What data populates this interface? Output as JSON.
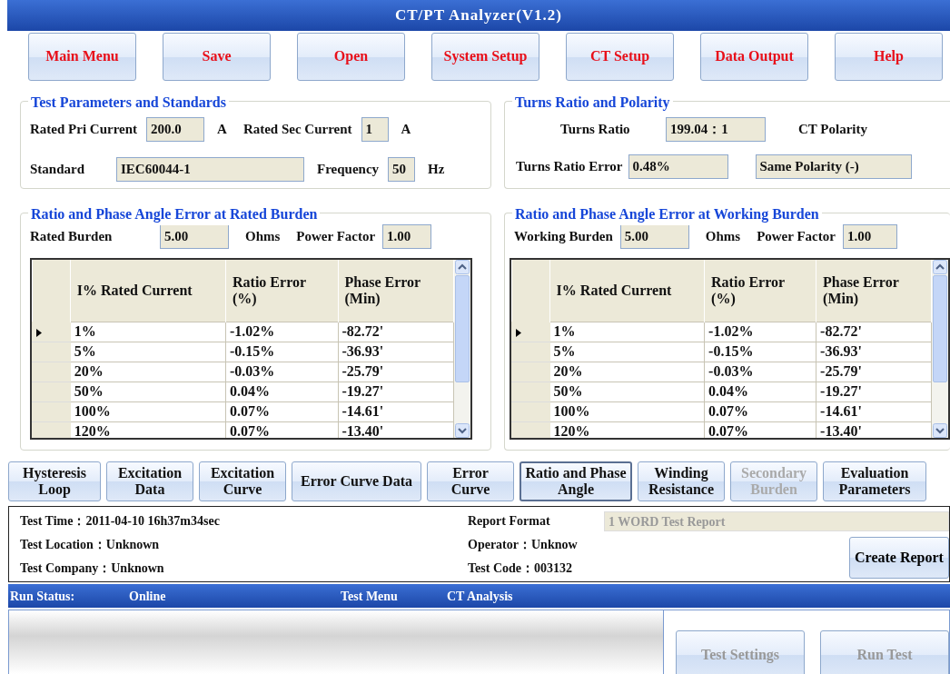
{
  "window": {
    "title": "CT/PT Analyzer(V1.2)"
  },
  "toolbar": [
    {
      "label": "Main Menu"
    },
    {
      "label": "Save"
    },
    {
      "label": "Open"
    },
    {
      "label": "System Setup"
    },
    {
      "label": "CT Setup"
    },
    {
      "label": "Data Output"
    },
    {
      "label": "Help"
    }
  ],
  "test_parameters": {
    "title": "Test Parameters and Standards",
    "rated_pri_label": "Rated Pri Current",
    "rated_pri_value": "200.0",
    "rated_pri_unit": "A",
    "rated_sec_label": "Rated Sec Current",
    "rated_sec_value": "1",
    "rated_sec_unit": "A",
    "standard_label": "Standard",
    "standard_value": "IEC60044-1",
    "frequency_label": "Frequency",
    "frequency_value": "50",
    "frequency_unit": "Hz"
  },
  "turns_ratio": {
    "title": "Turns Ratio and Polarity",
    "ratio_label": "Turns Ratio",
    "ratio_value": "199.04：1",
    "polarity_label": "CT Polarity",
    "error_label": "Turns Ratio Error",
    "error_value": "0.48%",
    "polarity_value": "Same Polarity (-)"
  },
  "burden_panels": [
    {
      "title": "Ratio and Phase Angle Error at Rated Burden",
      "burden_label": "Rated Burden",
      "burden_value": "5.00",
      "burden_unit": "Ohms",
      "pf_label": "Power Factor",
      "pf_value": "1.00",
      "table": {
        "columns": [
          "I% Rated Current",
          "Ratio Error (%)",
          "Phase Error (Min)"
        ],
        "rows": [
          {
            "cells": [
              "1%",
              "-1.02%",
              "-82.72'"
            ],
            "selected": true
          },
          {
            "cells": [
              "5%",
              "-0.15%",
              "-36.93'"
            ],
            "selected": false
          },
          {
            "cells": [
              "20%",
              "-0.03%",
              "-25.79'"
            ],
            "selected": false
          },
          {
            "cells": [
              "50%",
              "0.04%",
              "-19.27'"
            ],
            "selected": false
          },
          {
            "cells": [
              "100%",
              "0.07%",
              "-14.61'"
            ],
            "selected": false
          },
          {
            "cells": [
              "120%",
              "0.07%",
              "-13.40'"
            ],
            "selected": false
          }
        ]
      }
    },
    {
      "title": "Ratio and Phase Angle Error at Working Burden",
      "burden_label": "Working Burden",
      "burden_value": "5.00",
      "burden_unit": "Ohms",
      "pf_label": "Power Factor",
      "pf_value": "1.00",
      "table": {
        "columns": [
          "I% Rated Current",
          "Ratio Error (%)",
          "Phase Error (Min)"
        ],
        "rows": [
          {
            "cells": [
              "1%",
              "-1.02%",
              "-82.72'"
            ],
            "selected": true
          },
          {
            "cells": [
              "5%",
              "-0.15%",
              "-36.93'"
            ],
            "selected": false
          },
          {
            "cells": [
              "20%",
              "-0.03%",
              "-25.79'"
            ],
            "selected": false
          },
          {
            "cells": [
              "50%",
              "0.04%",
              "-19.27'"
            ],
            "selected": false
          },
          {
            "cells": [
              "100%",
              "0.07%",
              "-14.61'"
            ],
            "selected": false
          },
          {
            "cells": [
              "120%",
              "0.07%",
              "-13.40'"
            ],
            "selected": false
          }
        ]
      }
    }
  ],
  "tabs": [
    {
      "label": "Hysteresis Loop",
      "selected": false,
      "disabled": false
    },
    {
      "label": "Excitation Data",
      "selected": false,
      "disabled": false
    },
    {
      "label": "Excitation Curve",
      "selected": false,
      "disabled": false
    },
    {
      "label": "Error Curve Data",
      "selected": false,
      "disabled": false
    },
    {
      "label": "Error Curve",
      "selected": false,
      "disabled": false
    },
    {
      "label": "Ratio and Phase Angle",
      "selected": true,
      "disabled": false
    },
    {
      "label": "Winding Resistance",
      "selected": false,
      "disabled": false
    },
    {
      "label": "Secondary Burden",
      "selected": false,
      "disabled": true
    },
    {
      "label": "Evaluation Parameters",
      "selected": false,
      "disabled": false
    }
  ],
  "test_info": {
    "left": [
      {
        "label": "Test Time：",
        "value": "2011-04-10 16h37m34sec"
      },
      {
        "label": "Test Location：",
        "value": "Unknown"
      },
      {
        "label": "Test Company：",
        "value": "Unknown"
      }
    ],
    "report_format_label": "Report Format",
    "report_format_value": "1 WORD Test Report",
    "right": [
      {
        "label": "Operator：",
        "value": "Unknow"
      },
      {
        "label": "Test Code：",
        "value": "003132"
      }
    ],
    "create_report": "Create Report"
  },
  "status_bar": {
    "run_status_label": "Run Status:",
    "run_status_value": "Online",
    "test_menu_label": "Test Menu",
    "test_menu_value": "CT Analysis"
  },
  "bottom_buttons": [
    {
      "label": "Test Settings",
      "disabled": true
    },
    {
      "label": "Run Test",
      "disabled": true
    }
  ]
}
